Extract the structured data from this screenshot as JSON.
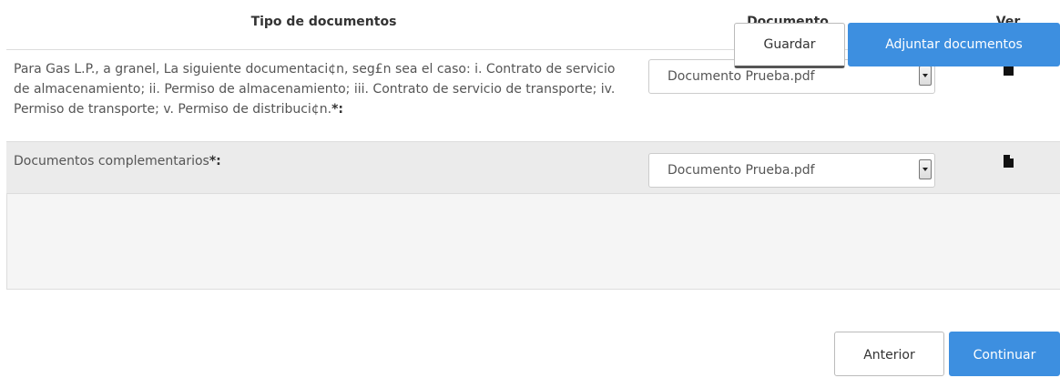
{
  "table": {
    "headers": {
      "type": "Tipo de documentos",
      "document": "Documento",
      "view": "Ver documento"
    },
    "rows": [
      {
        "type_text": "Para Gas L.P., a granel, La siguiente documentaci¢n, seg£n sea el caso: i. Contrato de servicio de almacenamiento; ii. Permiso de almacenamiento; iii. Contrato de servicio de transporte; iv. Permiso de transporte; v. Permiso de distribuci¢n.",
        "required_mark": "*:",
        "selected_document": "Documento Prueba.pdf",
        "view_icon": "file-icon"
      },
      {
        "type_text": "Documentos complementarios",
        "required_mark": "*:",
        "selected_document": "Documento Prueba.pdf",
        "view_icon": "file-icon"
      }
    ]
  },
  "actions": {
    "save_label": "Guardar",
    "attach_label": "Adjuntar documentos"
  },
  "navigation": {
    "previous_label": "Anterior",
    "continue_label": "Continuar"
  },
  "colors": {
    "primary": "#3d8fe0",
    "row_alt": "#ebebeb",
    "panel_bg": "#f5f5f5"
  }
}
